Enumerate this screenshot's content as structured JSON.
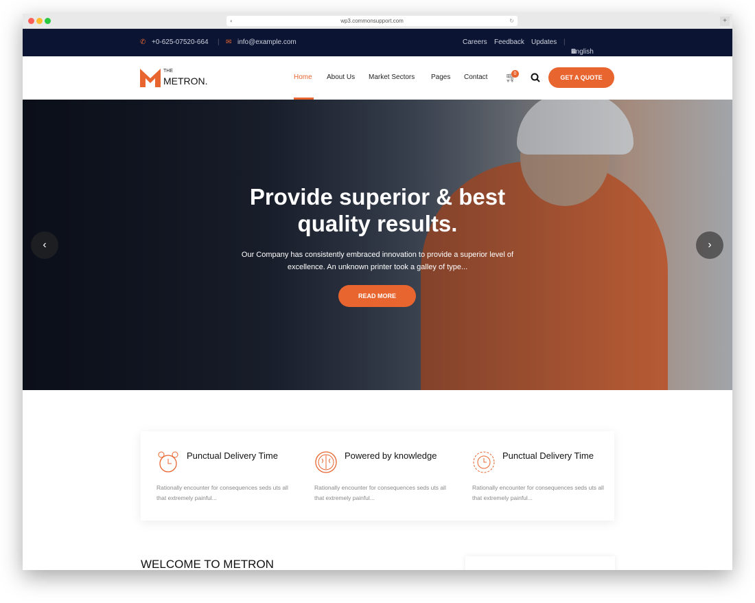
{
  "browser": {
    "url": "wp3.commonsupport.com"
  },
  "topbar": {
    "phone": "+0-625-07520-664",
    "email": "info@example.com",
    "links": [
      "Careers",
      "Feedback",
      "Updates"
    ],
    "language": "English"
  },
  "logo": {
    "the": "THE",
    "name": "METRON."
  },
  "nav": {
    "items": [
      "Home",
      "About Us",
      "Market Sectors",
      "Pages",
      "Contact"
    ],
    "cart_count": "0",
    "quote_button": "GET A QUOTE"
  },
  "hero": {
    "title_line1": "Provide superior & best",
    "title_line2": "quality results.",
    "text_line1": "Our Company has consistently embraced innovation to provide a superior level of",
    "text_line2": "excellence. An unknown printer took a galley of type...",
    "button": "READ MORE"
  },
  "features": [
    {
      "icon": "alarm-clock-icon",
      "title": "Punctual Delivery Time",
      "text": "Rationally encounter for consequences seds uts all that extremely painful..."
    },
    {
      "icon": "brain-icon",
      "title": "Powered by knowledge",
      "text": "Rationally encounter for consequences seds uts all that extremely painful..."
    },
    {
      "icon": "gear-clock-icon",
      "title": "Punctual Delivery Time",
      "text": "Rationally encounter for consequences seds uts all that extremely painful..."
    }
  ],
  "welcome": {
    "heading": "WELCOME TO METRON"
  },
  "colors": {
    "accent": "#e8652f",
    "topbar": "#0b1433"
  }
}
